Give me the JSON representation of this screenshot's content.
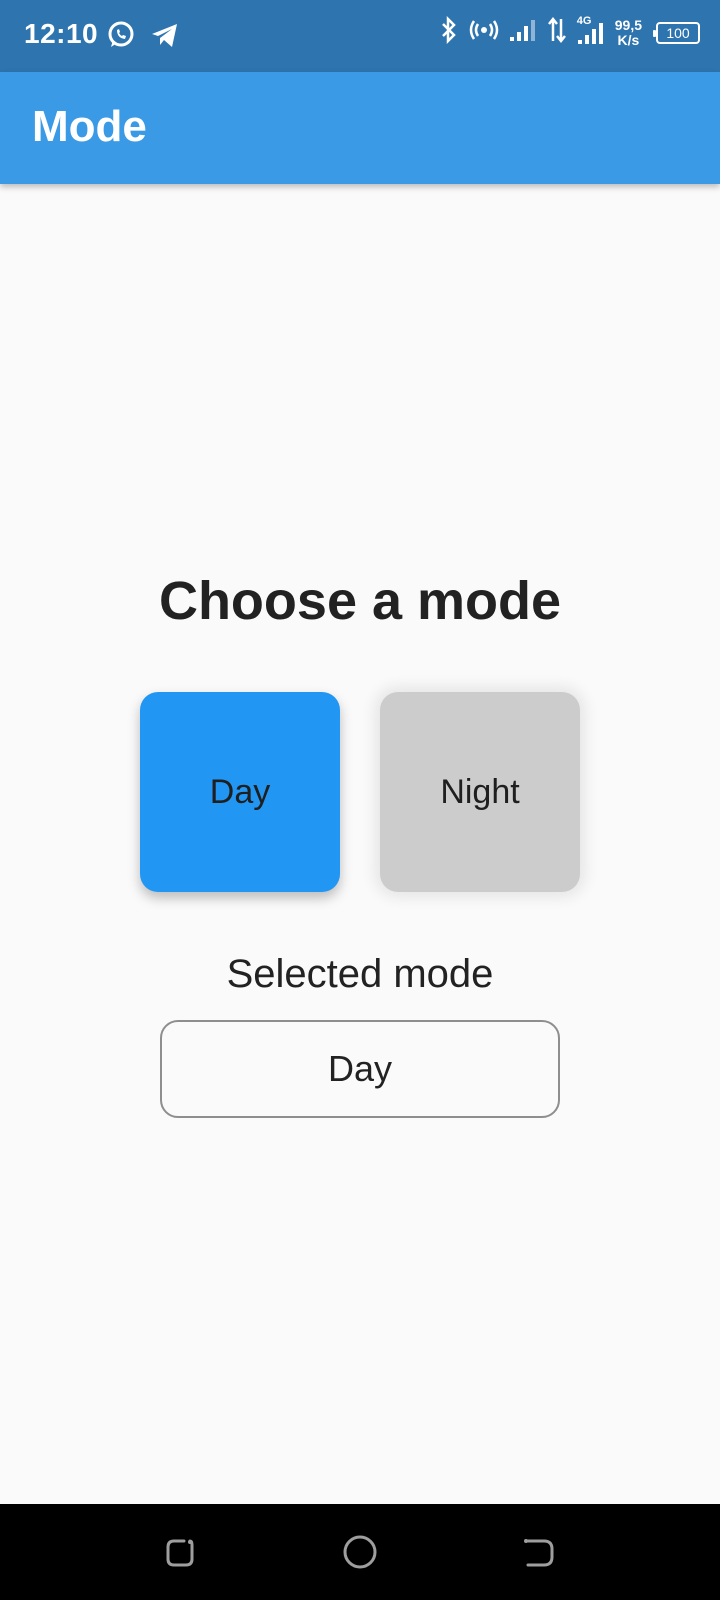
{
  "status_bar": {
    "time": "12:10",
    "left_icons": [
      "whatsapp-icon",
      "telegram-icon"
    ],
    "right_icons": [
      "bluetooth-icon",
      "hotspot-icon",
      "signal-icon",
      "data-arrows-icon",
      "signal-4g-icon"
    ],
    "network_label": "4G",
    "net_speed_value": "99,5",
    "net_speed_unit": "K/s",
    "battery": "100",
    "background_color": "#2e74af"
  },
  "app_bar": {
    "title": "Mode",
    "background_color": "#3b9ae5"
  },
  "content": {
    "heading": "Choose a mode",
    "modes": [
      {
        "label": "Day",
        "color": "#2196f3",
        "selected": true
      },
      {
        "label": "Night",
        "color": "#cccccc",
        "selected": false
      }
    ],
    "selected_label": "Selected mode",
    "selected_value": "Day"
  },
  "nav_bar": {
    "buttons": [
      "recent-apps-icon",
      "home-icon",
      "back-icon"
    ]
  }
}
